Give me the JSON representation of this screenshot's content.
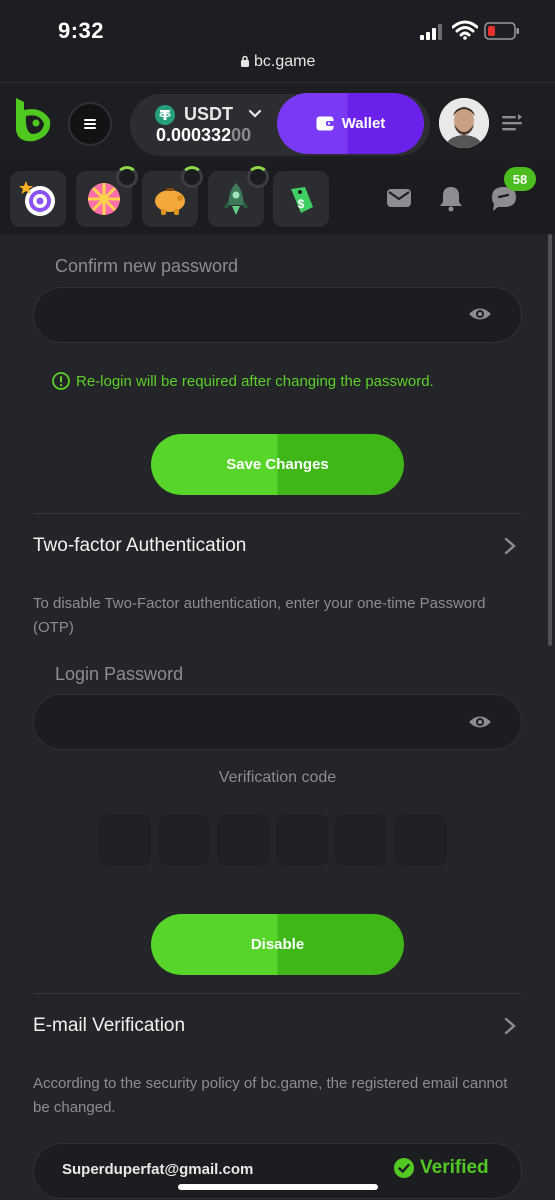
{
  "status": {
    "time": "9:32",
    "url": "bc.game"
  },
  "header": {
    "currency": "USDT",
    "amount_main": "0.000332",
    "amount_faded": "00",
    "wallet_label": "Wallet"
  },
  "notifications": {
    "chat_count": "58"
  },
  "password": {
    "confirm_label": "Confirm new password",
    "notice": "Re-login will be required after changing the password.",
    "save_label": "Save Changes"
  },
  "two_factor": {
    "title": "Two-factor Authentication",
    "description": "To disable Two-Factor authentication, enter your one-time Password (OTP)",
    "login_password_label": "Login Password",
    "verification_label": "Verification code",
    "disable_label": "Disable"
  },
  "email": {
    "title": "E-mail Verification",
    "description": "According to the security policy of bc.game, the registered email cannot be changed.",
    "address": "Superduperfat@gmail.com",
    "verified_label": "Verified"
  },
  "colors": {
    "accent_green": "#57d52a",
    "wallet_purple": "#7a3af5",
    "background": "#232528"
  },
  "icons": [
    "lock-icon",
    "bcgame-logo",
    "hamburger-icon",
    "tether-icon",
    "chevron-down-icon",
    "wallet-icon",
    "list-icon",
    "spin-target-icon",
    "lucky-wheel-icon",
    "piggy-bank-icon",
    "rocket-icon",
    "tag-icon",
    "mail-icon",
    "bell-icon",
    "chat-icon",
    "eye-icon",
    "info-circle-icon",
    "chevron-right-icon",
    "check-circle-icon"
  ]
}
